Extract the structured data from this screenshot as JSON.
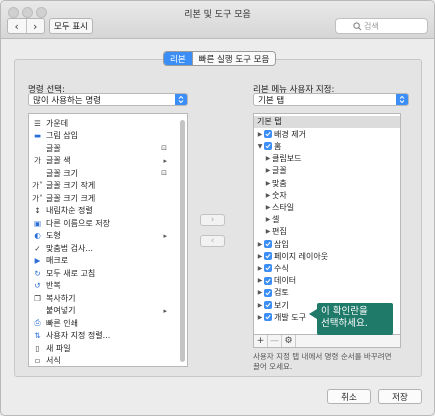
{
  "window": {
    "title": "리본 및 도구 모음"
  },
  "toolbar": {
    "back": "‹",
    "forward": "›",
    "show_all": "모두 표시",
    "search_placeholder": "검색"
  },
  "tabs": [
    {
      "label": "리본",
      "active": true
    },
    {
      "label": "빠른 실행 도구 모음",
      "active": false
    }
  ],
  "left": {
    "label": "명령 선택:",
    "dropdown_value": "많이 사용하는 명령",
    "commands": [
      {
        "icon": "align-center-icon",
        "label": "가운데",
        "trail": ""
      },
      {
        "icon": "insert-picture-icon",
        "label": "그림 삽입",
        "trail": ""
      },
      {
        "icon": "font-icon",
        "label": "글꼴",
        "trail": "expand-icon"
      },
      {
        "icon": "font-color-icon",
        "label": "글꼴 색",
        "trail": "submenu-icon"
      },
      {
        "icon": "font-size-icon",
        "label": "글꼴 크기",
        "trail": "expand-icon"
      },
      {
        "icon": "decrease-font-icon",
        "label": "글꼴 크기 작게",
        "trail": ""
      },
      {
        "icon": "increase-font-icon",
        "label": "글꼴 크기 크게",
        "trail": ""
      },
      {
        "icon": "sort-descending-icon",
        "label": "내림차순 정렬",
        "trail": ""
      },
      {
        "icon": "save-as-icon",
        "label": "다른 이름으로 저장",
        "trail": ""
      },
      {
        "icon": "shapes-icon",
        "label": "도형",
        "trail": "submenu-icon"
      },
      {
        "icon": "spelling-icon",
        "label": "맞춤법 검사...",
        "trail": ""
      },
      {
        "icon": "macro-icon",
        "label": "매크로",
        "trail": ""
      },
      {
        "icon": "refresh-all-icon",
        "label": "모두 새로 고침",
        "trail": ""
      },
      {
        "icon": "repeat-icon",
        "label": "반복",
        "trail": ""
      },
      {
        "icon": "copy-icon",
        "label": "복사하기",
        "trail": ""
      },
      {
        "icon": "paste-icon",
        "label": "붙여넣기",
        "trail": "submenu-icon"
      },
      {
        "icon": "quick-print-icon",
        "label": "빠른 인쇄",
        "trail": ""
      },
      {
        "icon": "custom-sort-icon",
        "label": "사용자 지정 정렬...",
        "trail": ""
      },
      {
        "icon": "new-file-icon",
        "label": "새 파일",
        "trail": ""
      },
      {
        "icon": "generic-icon",
        "label": "서식",
        "trail": ""
      }
    ]
  },
  "middle": {
    "add": "›",
    "remove": "‹"
  },
  "right": {
    "label": "리본 메뉴 사용자 지정:",
    "dropdown_value": "기본 탭",
    "header": "기본 탭",
    "items": [
      {
        "label": "배경 제거",
        "level": 0,
        "expanded": false,
        "checked": true
      },
      {
        "label": "홈",
        "level": 0,
        "expanded": true,
        "checked": true
      },
      {
        "label": "클립보드",
        "level": 1,
        "expanded": false,
        "checked": false
      },
      {
        "label": "글꼴",
        "level": 1,
        "expanded": false,
        "checked": false
      },
      {
        "label": "맞춤",
        "level": 1,
        "expanded": false,
        "checked": false
      },
      {
        "label": "숫자",
        "level": 1,
        "expanded": false,
        "checked": false
      },
      {
        "label": "스타일",
        "level": 1,
        "expanded": false,
        "checked": false
      },
      {
        "label": "셀",
        "level": 1,
        "expanded": false,
        "checked": false
      },
      {
        "label": "편집",
        "level": 1,
        "expanded": false,
        "checked": false
      },
      {
        "label": "삽입",
        "level": 0,
        "expanded": false,
        "checked": true
      },
      {
        "label": "페이지 레이아웃",
        "level": 0,
        "expanded": false,
        "checked": true
      },
      {
        "label": "수식",
        "level": 0,
        "expanded": false,
        "checked": true
      },
      {
        "label": "데이터",
        "level": 0,
        "expanded": false,
        "checked": true
      },
      {
        "label": "검토",
        "level": 0,
        "expanded": false,
        "checked": true
      },
      {
        "label": "보기",
        "level": 0,
        "expanded": false,
        "checked": true
      },
      {
        "label": "개발 도구",
        "level": 0,
        "expanded": false,
        "checked": true
      }
    ],
    "bottom_buttons": {
      "add": "+",
      "remove": "—"
    }
  },
  "callout": {
    "line1": "이 확인란을",
    "line2": "선택하세요."
  },
  "hint": {
    "line1": "사용자 지정 탭 내에서 명령 순서를 바꾸려면",
    "line2": "끌어 오세요."
  },
  "footer": {
    "cancel": "취소",
    "save": "저장"
  },
  "colors": {
    "accent": "#3a8ef6",
    "callout": "#1f7a6a"
  }
}
